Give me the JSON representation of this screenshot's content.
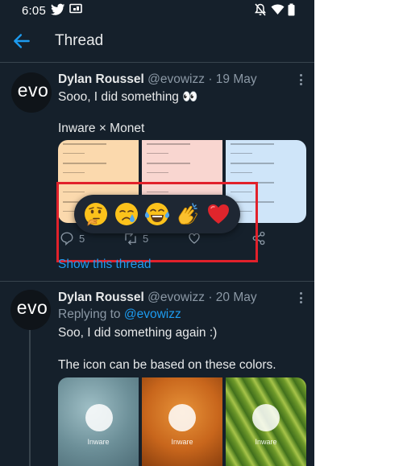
{
  "status_bar": {
    "time": "6:05",
    "icons": [
      "twitter-icon",
      "screen-cast-icon",
      "bell-off-icon",
      "wifi-icon",
      "battery-icon"
    ]
  },
  "header": {
    "title": "Thread",
    "back_icon": "arrow-left-icon"
  },
  "tweets": [
    {
      "avatar_text": "evo",
      "name": "Dylan Roussel",
      "handle": "@evowizz",
      "date": "· 19 May",
      "text1": "Sooo, I did something 👀",
      "text2": "Inware × Monet",
      "reply_count": "5",
      "retweet_count": "5",
      "show_thread": "Show this thread"
    },
    {
      "avatar_text": "evo",
      "name": "Dylan Roussel",
      "handle": "@evowizz",
      "date": "· 20 May",
      "replying_prefix": "Replying to",
      "replying_handle": "@evowizz",
      "text1": "Soo, I did something again :)",
      "text2": "The icon can be based on these colors.",
      "photo_label": "Inware"
    }
  ],
  "reactions": [
    "thinking-face",
    "crying-face",
    "tears-of-joy-face",
    "clapping-hands",
    "red-heart"
  ],
  "colors": {
    "background": "#15202b",
    "accent": "#1d9bf0",
    "highlight_box": "#e1212b",
    "card_1": "#fbd9ad",
    "card_2": "#f9d6d0",
    "card_3": "#cfe5f9"
  }
}
